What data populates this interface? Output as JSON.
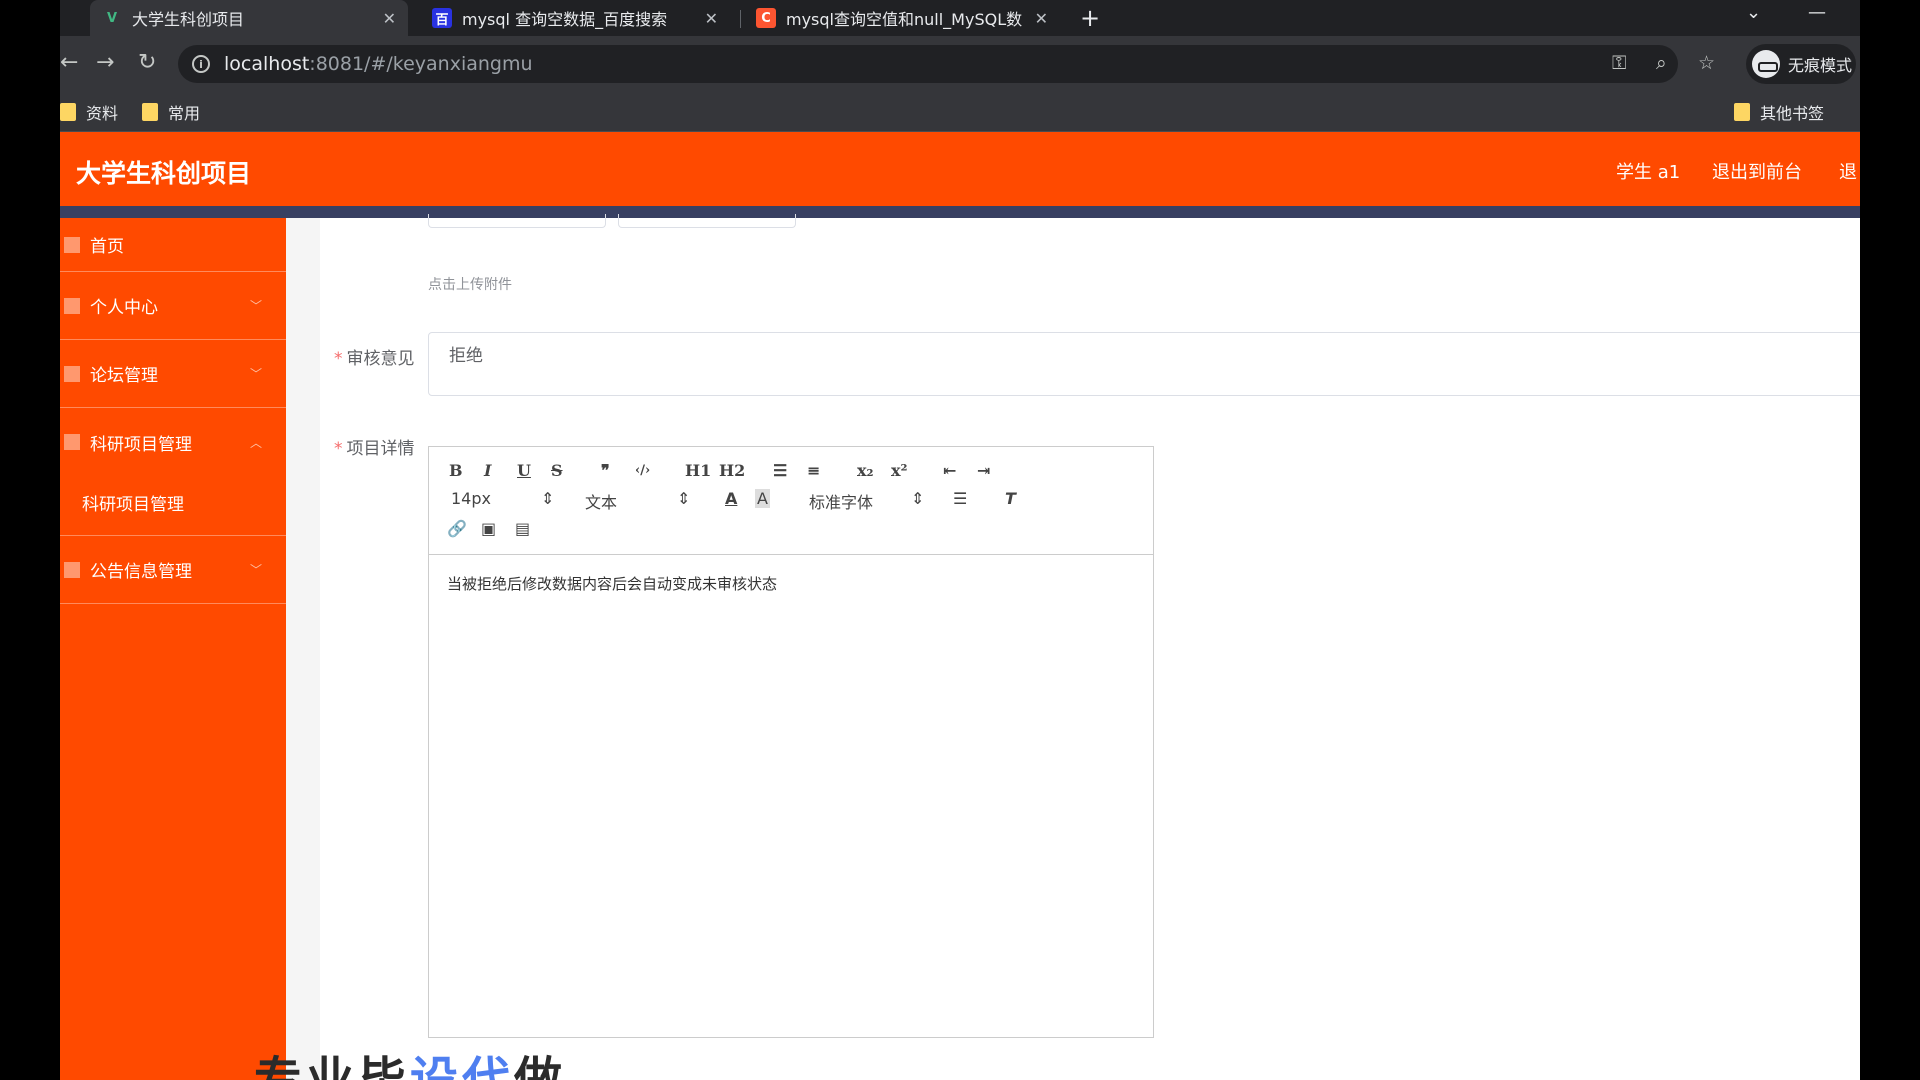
{
  "browser": {
    "tabs": [
      {
        "title": "大学生科创项目",
        "favicon": "vue-icon"
      },
      {
        "title": "mysql 查询空数据_百度搜索",
        "favicon": "baidu-icon"
      },
      {
        "title": "mysql查询空值和null_MySQL数",
        "favicon": "csdn-icon"
      }
    ],
    "url_host": "localhost",
    "url_rest": ":8081/#/keyanxiangmu",
    "profile_label": "无痕模式",
    "bookmarks": [
      "资料",
      "常用"
    ],
    "other_bookmarks": "其他书签"
  },
  "app": {
    "title": "大学生科创项目",
    "user_label": "学生 a1",
    "exit_front": "退出到前台",
    "exit_short": "退"
  },
  "sidebar": {
    "items": [
      {
        "label": "首页",
        "icon": "home-icon"
      },
      {
        "label": "个人中心",
        "icon": "user-icon"
      },
      {
        "label": "论坛管理",
        "icon": "grid-icon"
      },
      {
        "label": "科研项目管理",
        "icon": "flag-icon"
      },
      {
        "label": "公告信息管理",
        "icon": "doc-icon"
      }
    ],
    "sub_items": [
      "科研项目管理"
    ]
  },
  "form": {
    "upload_hint": "点击上传附件",
    "review_label": "审核意见",
    "review_value": "拒绝",
    "detail_label": "项目详情",
    "required_mark": "*"
  },
  "editor": {
    "buttons_row1": [
      "B",
      "I",
      "U",
      "S",
      "❞",
      "‹/›",
      "H1",
      "H2",
      "☰",
      "≡",
      "x₂",
      "x²",
      "⇤",
      "⇥"
    ],
    "font_size": "14px",
    "paragraph": "文本",
    "font_family": "标准字体",
    "content": "当被拒绝后修改数据内容后会自动变成未审核状态"
  },
  "overlay_text": {
    "part1": "专业毕",
    "part2": "设代",
    "part3": "做"
  }
}
